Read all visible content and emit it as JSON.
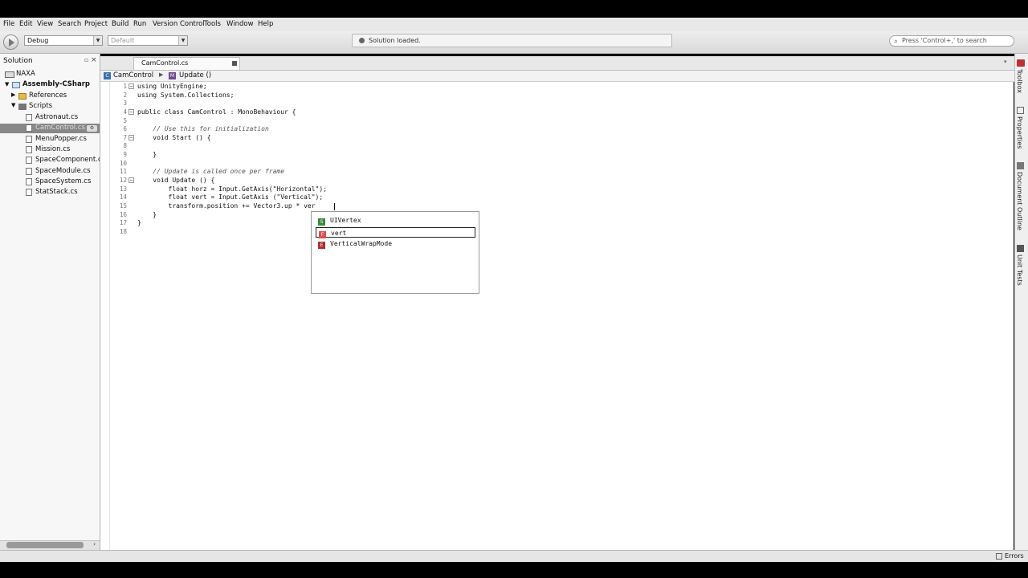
{
  "menu": [
    "File",
    "Edit",
    "View",
    "Search",
    "Project",
    "Build",
    "Run",
    "Version Control",
    "Tools",
    "Window",
    "Help"
  ],
  "toolbar": {
    "config": "Debug",
    "platform": "Default",
    "status": "Solution loaded.",
    "search_placeholder": "Press 'Control+,' to search"
  },
  "solution_pad": {
    "title": "Solution",
    "root": "NAXA",
    "project": "Assembly-CSharp",
    "references": "References",
    "scripts_folder": "Scripts",
    "files": [
      "Astronaut.cs",
      "CamControl.cs",
      "MenuPopper.cs",
      "Mission.cs",
      "SpaceComponent.cs",
      "SpaceModule.cs",
      "SpaceSystem.cs",
      "StatStack.cs"
    ],
    "selected_file": "CamControl.cs"
  },
  "editor": {
    "tab": "CamControl.cs",
    "breadcrumb_class": "CamControl",
    "breadcrumb_method": "Update ()",
    "lines": [
      "using UnityEngine;",
      "using System.Collections;",
      "",
      "public class CamControl : MonoBehaviour {",
      "",
      "    // Use this for initialization",
      "    void Start () {",
      "",
      "    }",
      "",
      "    // Update is called once per frame",
      "    void Update () {",
      "        float horz = Input.GetAxis(\"Horizontal\");",
      "        float vert = Input.GetAxis (\"Vertical\");",
      "        transform.position += Vector3.up * ver",
      "    }",
      "}",
      ""
    ]
  },
  "completion": {
    "items": [
      {
        "label": "UIVertex",
        "kind": "S",
        "color": "#3a8a3a"
      },
      {
        "label": "vert",
        "kind": "F",
        "color": "#c0392b"
      },
      {
        "label": "VerticalWrapMode",
        "kind": "E",
        "color": "#b03030"
      }
    ],
    "selected": "vert"
  },
  "right_pads": [
    "Toolbox",
    "Properties",
    "Document Outline",
    "Unit Tests"
  ],
  "statusbar": {
    "errors_label": "Errors"
  }
}
